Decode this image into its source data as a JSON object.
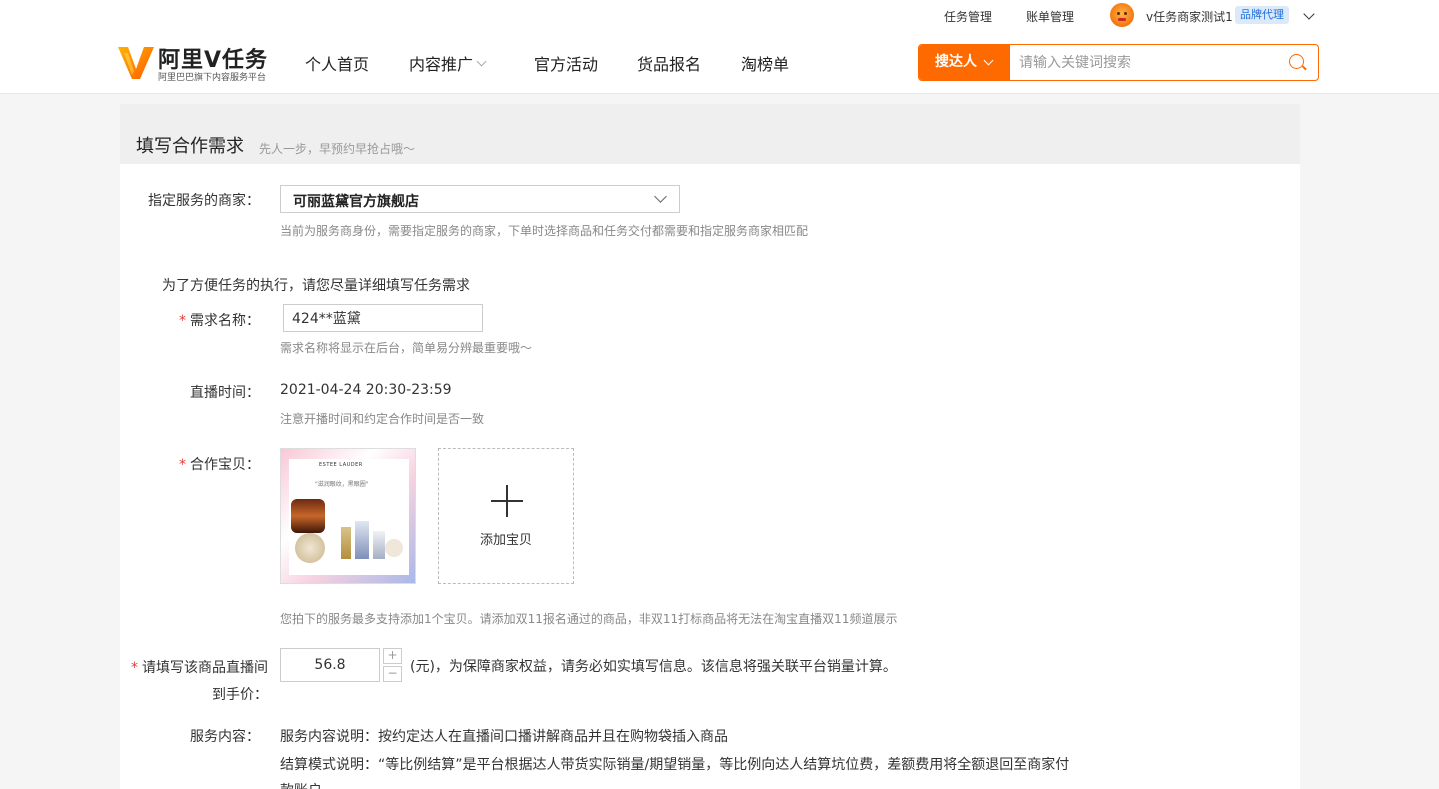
{
  "topbar": {
    "task_management": "任务管理",
    "bill_management": "账单管理",
    "username": "v任务商家测试1",
    "badge": "品牌代理"
  },
  "header": {
    "logo_title": "阿里V任务",
    "logo_subtitle": "阿里巴巴旗下内容服务平台",
    "nav": [
      "个人首页",
      "内容推广",
      "官方活动",
      "货品报名",
      "淘榜单"
    ]
  },
  "search": {
    "type_label": "搜达人",
    "placeholder": "请输入关键词搜索"
  },
  "form": {
    "title": "填写合作需求",
    "subtitle": "先人一步，早预约早抢占哦～",
    "merchant": {
      "label": "指定服务的商家：",
      "value": "可丽蓝黛官方旗舰店",
      "hint": "当前为服务商身份，需要指定服务的商家，下单时选择商品和任务交付都需要和指定服务商家相匹配"
    },
    "intro": "为了方便任务的执行，请您尽量详细填写任务需求",
    "demand_name": {
      "required": "*",
      "label": "需求名称：",
      "value": "424**蓝黛",
      "hint": "需求名称将显示在后台，简单易分辨最重要哦～"
    },
    "live_time": {
      "label": "直播时间：",
      "value": "2021-04-24 20:30-23:59",
      "hint": "注意开播时间和约定合作时间是否一致"
    },
    "product": {
      "required": "*",
      "label": "合作宝贝：",
      "thumb_brand": "ESTEE LAUDER",
      "thumb_tag": "\"滋润眼纹，黑眼圈\"",
      "add_label": "添加宝贝",
      "hint": "您拍下的服务最多支持添加1个宝贝。请添加双11报名通过的商品，非双11打标商品将无法在淘宝直播双11频道展示"
    },
    "price": {
      "required": "*",
      "label_line1": "请填写该商品直播间",
      "label_line2": "到手价：",
      "value": "56.8",
      "plus": "+",
      "minus": "−",
      "note": "(元)，为保障商家权益，请务必如实填写信息。该信息将强关联平台销量计算。"
    },
    "service": {
      "label": "服务内容：",
      "line1": "服务内容说明：按约定达人在直播间口播讲解商品并且在购物袋插入商品",
      "line2": "结算模式说明：“等比例结算”是平台根据达人带货实际销量/期望销量，等比例向达人结算坑位费，差额费用将全额退回至商家付",
      "line3": "款账户"
    }
  },
  "colors": {
    "accent": "#ff6a00",
    "required": "#e4393c",
    "badge_bg": "#dbe9fb",
    "badge_text": "#1e6fd9"
  }
}
